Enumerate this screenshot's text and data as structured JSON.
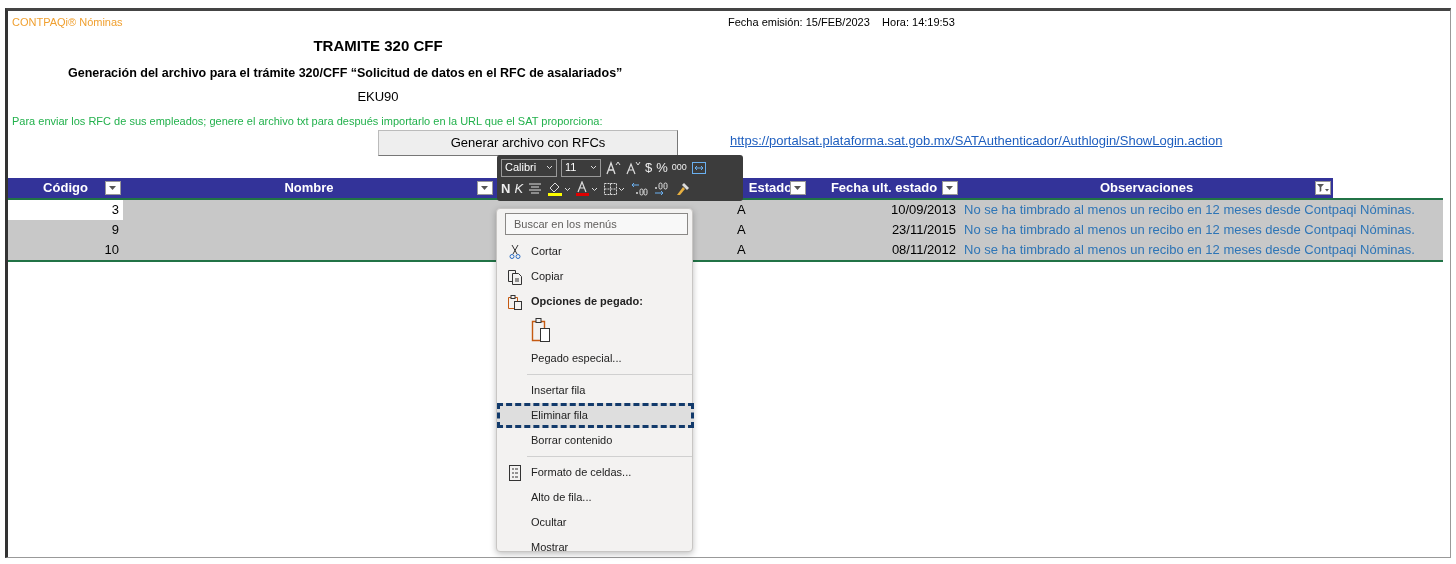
{
  "app_label": "CONTPAQi® Nóminas",
  "issue_info": "Fecha emisión: 15/FEB/2023    Hora: 14:19:53",
  "title": "TRAMITE 320 CFF",
  "subtitle": "Generación del archivo para el trámite 320/CFF “Solicitud de datos en el RFC de asalariados”",
  "company_code": "EKU90",
  "instructions": "Para enviar los RFC de sus empleados; genere el archivo txt para después importarlo en la  URL que el SAT proporciona:",
  "generate_button": "Generar archivo con RFCs",
  "sat_link": "https://portalsat.plataforma.sat.gob.mx/SATAuthenticador/Authlogin/ShowLogin.action",
  "table": {
    "columns": [
      {
        "label": "Código",
        "filtered": false
      },
      {
        "label": "Nombre",
        "filtered": false
      },
      {
        "label": "Estado",
        "filtered": false
      },
      {
        "label": "Fecha ult. estado",
        "filtered": false
      },
      {
        "label": "Observaciones",
        "filtered": true
      }
    ],
    "rows": [
      {
        "codigo": "3",
        "estado": "A",
        "fecha": "10/09/2013",
        "observaciones": "No se ha timbrado al menos un recibo en 12 meses desde Contpaqi Nóminas.",
        "selected": true,
        "active": true
      },
      {
        "codigo": "9",
        "estado": "A",
        "fecha": "23/11/2015",
        "observaciones": "No se ha timbrado al menos un recibo en 12 meses desde Contpaqi Nóminas.",
        "selected": true,
        "active": false
      },
      {
        "codigo": "10",
        "estado": "A",
        "fecha": "08/11/2012",
        "observaciones": "No se ha timbrado al menos un recibo en 12 meses desde Contpaqi Nóminas.",
        "selected": true,
        "active": false
      }
    ]
  },
  "mini_toolbar": {
    "font": "Calibri",
    "size": "11",
    "bold": "N",
    "italic": "K",
    "currency": "$",
    "percent": "%",
    "thousands": "000"
  },
  "context_menu": {
    "search_placeholder": "Buscar en los menús",
    "items": [
      {
        "kind": "cut",
        "label": "Cortar",
        "selected": false
      },
      {
        "kind": "copy",
        "label": "Copiar",
        "selected": false
      },
      {
        "kind": "paste-header",
        "label": "Opciones de pegado:"
      },
      {
        "kind": "paste-options"
      },
      {
        "kind": "plain",
        "label": "Pegado especial...",
        "selected": false
      },
      {
        "kind": "separator"
      },
      {
        "kind": "plain",
        "label": "Insertar fila",
        "selected": false
      },
      {
        "kind": "plain",
        "label": "Eliminar fila",
        "selected": true
      },
      {
        "kind": "plain",
        "label": "Borrar contenido",
        "selected": false
      },
      {
        "kind": "separator"
      },
      {
        "kind": "format",
        "label": "Formato de celdas...",
        "selected": false
      },
      {
        "kind": "plain",
        "label": "Alto de fila...",
        "selected": false
      },
      {
        "kind": "plain",
        "label": "Ocultar",
        "selected": false
      },
      {
        "kind": "plain",
        "label": "Mostrar",
        "selected": false
      }
    ]
  }
}
